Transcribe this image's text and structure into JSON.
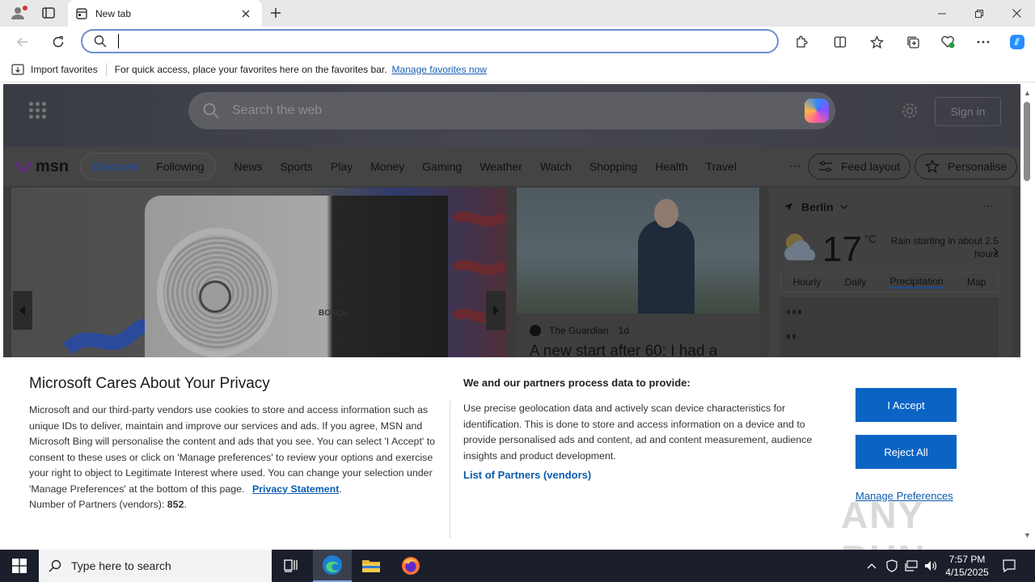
{
  "browser": {
    "tab_title": "New tab",
    "address_placeholder": ""
  },
  "favorites_bar": {
    "import_label": "Import favorites",
    "message": "For quick access, place your favorites here on the favorites bar.",
    "manage_link": "Manage favorites now"
  },
  "msn": {
    "search_placeholder": "Search the web",
    "sign_in": "Sign in",
    "logo_text": "msn",
    "pills": [
      "Discover",
      "Following"
    ],
    "nav_items": [
      "News",
      "Sports",
      "Play",
      "Money",
      "Gaming",
      "Weather",
      "Watch",
      "Shopping",
      "Health",
      "Travel"
    ],
    "more": "···",
    "feed_layout": "Feed layout",
    "personalise": "Personalise"
  },
  "hero_card": {
    "brand": "BOSCH"
  },
  "news_card": {
    "source": "The Guardian",
    "age": "· 1d",
    "headline": "A new start after 60: I had a"
  },
  "weather": {
    "city": "Berlin",
    "temp": "17",
    "unit": "°C",
    "note": "Rain starting in about 2.5 hours",
    "tabs": [
      "Hourly",
      "Daily",
      "Precipitation",
      "Map"
    ],
    "active_tab": "Precipitation"
  },
  "consent": {
    "title": "Microsoft Cares About Your Privacy",
    "body": "Microsoft and our third-party vendors use cookies to store and access information such as unique IDs to deliver, maintain and improve our services and ads. If you agree, MSN and Microsoft Bing will personalise the content and ads that you see. You can select 'I Accept' to consent to these uses or click on 'Manage preferences' to review your options and exercise your right to object to Legitimate Interest where used.  You can change your selection under 'Manage Preferences' at the bottom of this page.",
    "privacy_link": "Privacy Statement",
    "partners_count_label": "Number of Partners (vendors):",
    "partners_count": "852",
    "subtitle": "We and our partners process data to provide:",
    "body2": "Use precise geolocation data and actively scan device characteristics for identification. This is done to store and access information on a device and to provide personalised ads and content, ad and content measurement, audience insights and product development.",
    "partners_link": "List of Partners (vendors)",
    "accept": "I Accept",
    "reject": "Reject All",
    "manage": "Manage Preferences",
    "watermark": "ANY RUN"
  },
  "taskbar": {
    "search_placeholder": "Type here to search",
    "time": "7:57 PM",
    "date": "4/15/2025"
  },
  "colors": {
    "accent": "#0b64c4",
    "link": "#0b5cad",
    "address_border": "#6d8fd0",
    "taskbar": "#1b1f2b"
  }
}
